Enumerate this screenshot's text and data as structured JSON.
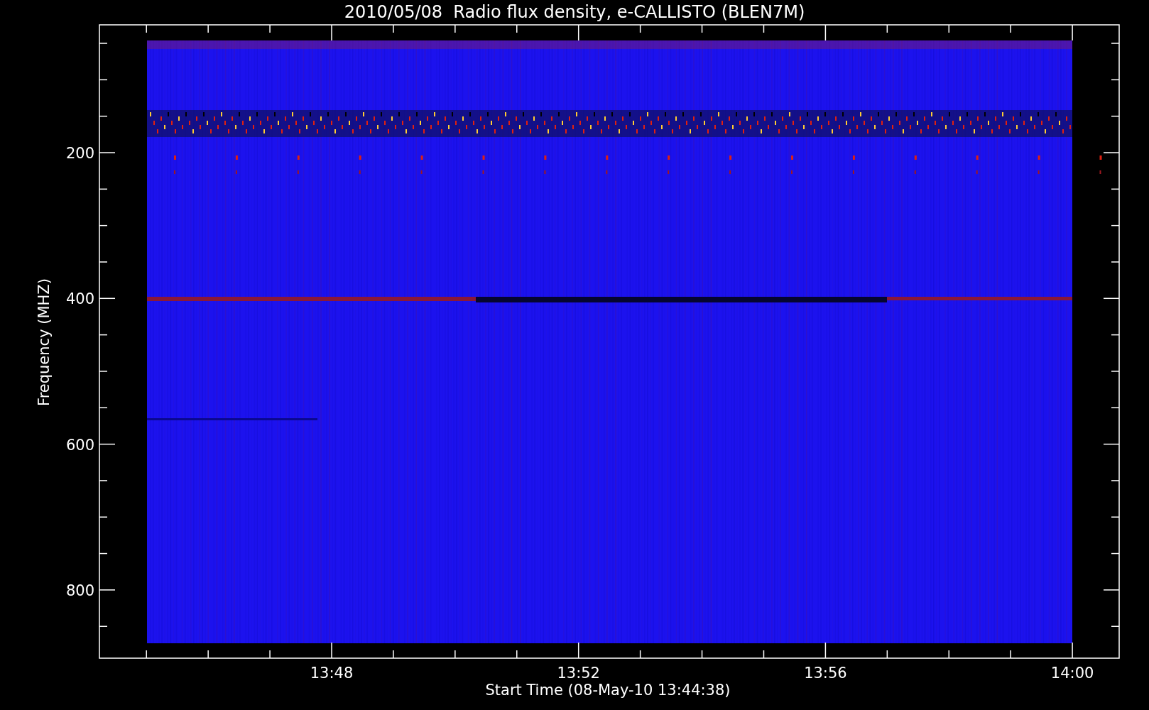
{
  "title": "2010/05/08  Radio flux density, e-CALLISTO (BLEN7M)",
  "y_axis": {
    "label": "Frequency (MHZ)",
    "ticks": [
      "200",
      "400",
      "600",
      "800"
    ]
  },
  "x_axis": {
    "label": "Start Time (08-May-10 13:44:38)",
    "ticks": [
      "13:48",
      "13:52",
      "13:56",
      "14:00"
    ]
  }
}
